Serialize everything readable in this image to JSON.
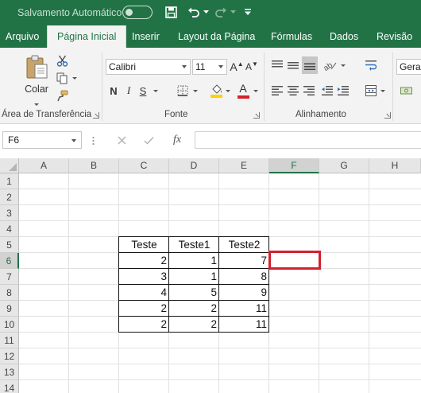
{
  "titlebar": {
    "autosave_label": "Salvamento Automático",
    "icons": [
      "save-icon",
      "undo-icon",
      "redo-icon",
      "customize-qat-icon"
    ]
  },
  "tabs": [
    "Arquivo",
    "Página Inicial",
    "Inserir",
    "Layout da Página",
    "Fórmulas",
    "Dados",
    "Revisão"
  ],
  "active_tab": "Página Inicial",
  "ribbon": {
    "clipboard": {
      "paste_label": "Colar",
      "group_label": "Área de Transferência"
    },
    "font": {
      "font_name": "Calibri",
      "font_size": "11",
      "bold": "N",
      "italic": "I",
      "underline": "S",
      "group_label": "Fonte",
      "fill_color": "#ffd200",
      "font_color": "#d5202d"
    },
    "alignment": {
      "group_label": "Alinhamento"
    },
    "number": {
      "format": "Geral"
    }
  },
  "formula_bar": {
    "name_box": "F6",
    "fx_label": "fx",
    "content": ""
  },
  "grid": {
    "columns": [
      "A",
      "B",
      "C",
      "D",
      "E",
      "F",
      "G",
      "H"
    ],
    "rows": [
      "1",
      "2",
      "3",
      "4",
      "5",
      "6",
      "7",
      "8",
      "9",
      "10",
      "11",
      "12",
      "13",
      "14"
    ],
    "selected_cell": "F6",
    "accent_color": "#217346",
    "selection_color": "#d5202d"
  },
  "table": {
    "headers": [
      "Teste",
      "Teste1",
      "Teste2"
    ],
    "rows": [
      [
        "2",
        "1",
        "7"
      ],
      [
        "3",
        "1",
        "8"
      ],
      [
        "4",
        "5",
        "9"
      ],
      [
        "2",
        "2",
        "11"
      ],
      [
        "2",
        "2",
        "11"
      ]
    ]
  }
}
